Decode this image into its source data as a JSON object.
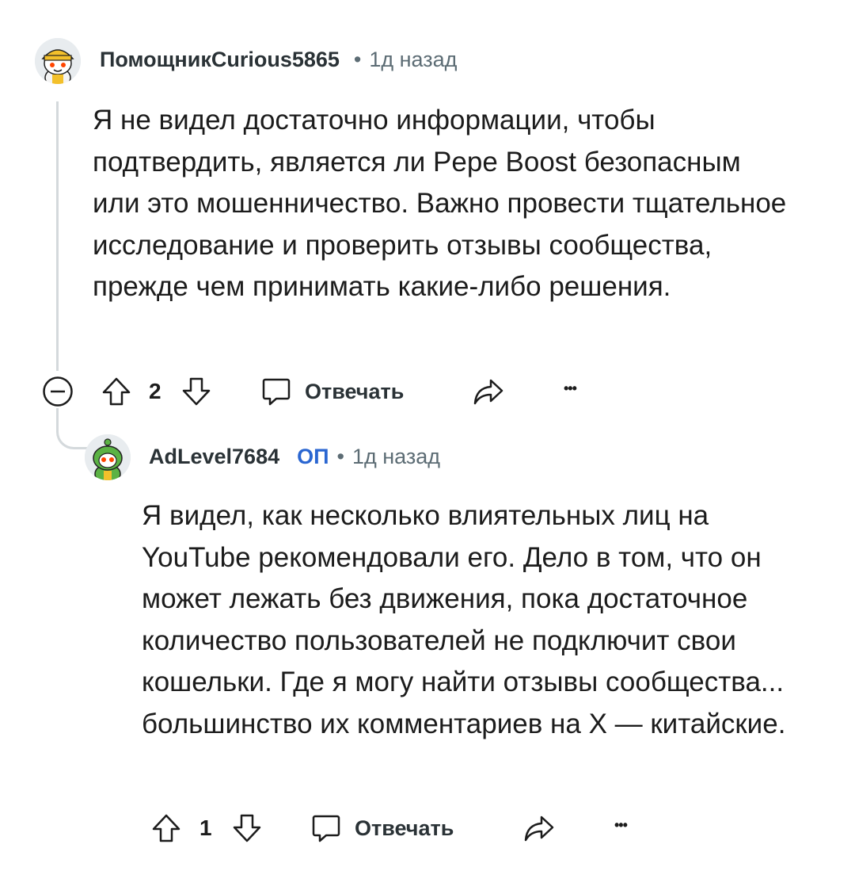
{
  "comments": [
    {
      "username": "ПомощникCurious5865",
      "separator": "•",
      "time": "1д назад",
      "text": "Я не видел достаточно информации, чтобы подтвердить, является ли Pepe Boost безопасным или это мошенничество. Важно провести тщательное исследование и проверить отзывы сообщества, прежде чем принимать какие-либо решения.",
      "votes": "2",
      "reply_label": "Отвечать",
      "more_label": "•••",
      "avatar_icon": "snoo-yellow-hat-avatar"
    },
    {
      "username": "AdLevel7684",
      "op_badge": "ОП",
      "separator": "•",
      "time": "1д назад",
      "text": "Я видел, как несколько влиятельных лиц на YouTube рекомендовали его. Дело в том, что он может лежать без движения, пока достаточное количество пользователей не подключит свои кошельки. Где я могу найти отзывы сообщества... большинство их комментариев на X — китайские.",
      "votes": "1",
      "reply_label": "Отвечать",
      "more_label": "•••",
      "avatar_icon": "snoo-green-avatar"
    }
  ],
  "colors": {
    "background": "#ffffff",
    "text": "#1c1c1c",
    "meta": "#5c6c74",
    "op_badge": "#2a66d1",
    "thread_line": "#d4d9dc"
  }
}
